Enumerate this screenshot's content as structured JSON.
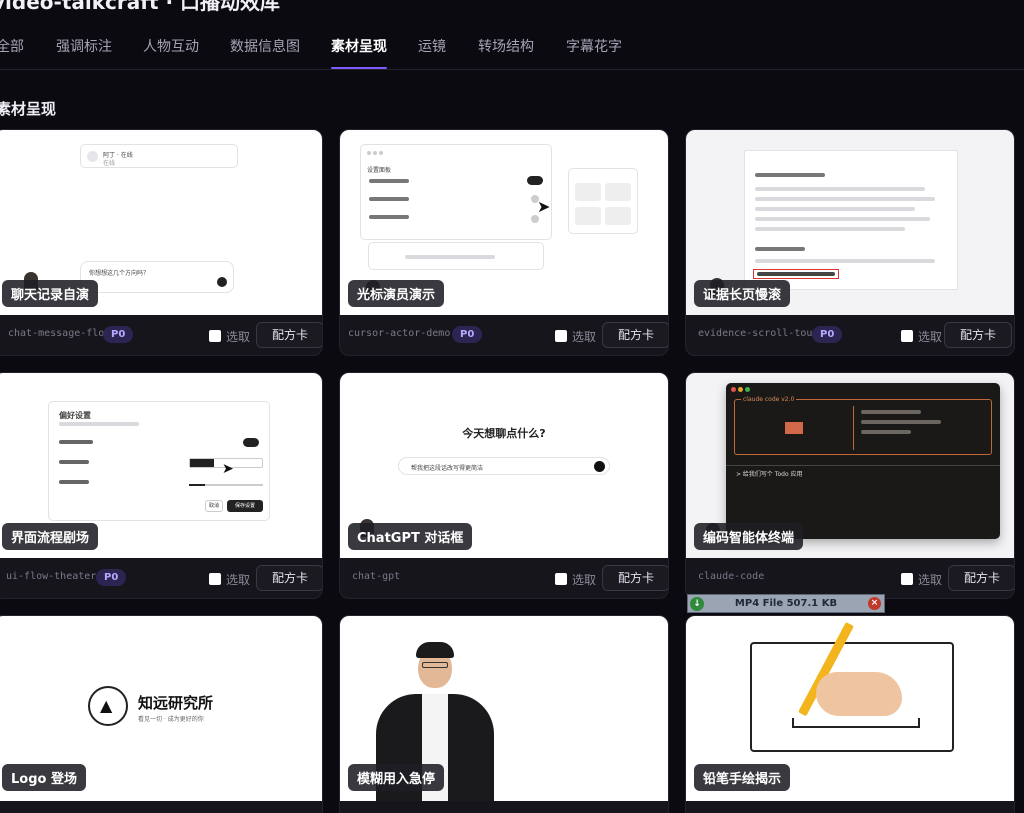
{
  "header": {
    "title": "video-talkcraft · 口播动效库"
  },
  "tabs": [
    {
      "label": "全部"
    },
    {
      "label": "强调标注"
    },
    {
      "label": "人物互动"
    },
    {
      "label": "数据信息图"
    },
    {
      "label": "素材呈现"
    },
    {
      "label": "运镜"
    },
    {
      "label": "转场结构"
    },
    {
      "label": "字幕花字"
    }
  ],
  "active_tab": "素材呈现",
  "section": {
    "title": "素材呈现"
  },
  "common": {
    "select_label": "选取",
    "recipe_label": "配方卡",
    "badge": "P0"
  },
  "cards": [
    {
      "label": "聊天记录自演",
      "slug": "chat-message-flow",
      "badge": "P0"
    },
    {
      "label": "光标演员演示",
      "slug": "cursor-actor-demo",
      "badge": "P0"
    },
    {
      "label": "证据长页慢滚",
      "slug": "evidence-scroll-tour",
      "badge": "P0"
    },
    {
      "label": "界面流程剧场",
      "slug": "ui-flow-theater",
      "badge": "P0"
    },
    {
      "label": "ChatGPT 对话框",
      "slug": "chat-gpt",
      "badge": ""
    },
    {
      "label": "编码智能体终端",
      "slug": "claude-code",
      "badge": ""
    },
    {
      "label": "Logo 登场",
      "slug": "",
      "badge": ""
    },
    {
      "label": "模糊用入急停",
      "slug": "",
      "badge": ""
    },
    {
      "label": "铅笔手绘揭示",
      "slug": "",
      "badge": ""
    }
  ],
  "thumbs": {
    "chat": {
      "contact": "阿丁 · 在线",
      "status": "在线",
      "input": "你想想这几个方向吗？"
    },
    "cursor": {
      "section": "设置面板"
    },
    "gpt": {
      "prompt": "今天想聊点什么?",
      "input": "帮我把这段话改写得更简洁"
    },
    "ui_flow": {
      "title": "偏好设置",
      "primary": "保存设置",
      "cancel": "取消"
    },
    "terminal": {
      "title": "claude code v2.0",
      "prompt": "> 给我们写个 Todo 应用"
    },
    "logo": {
      "name": "知远研究所",
      "tagline": "看见一切 · 成为更好的你"
    }
  },
  "file_banner": {
    "text": "MP4 File 507.1 KB"
  },
  "colors": {
    "accent": "#7c5cff",
    "background": "#0b0a10",
    "badge_bg": "#2c2552"
  }
}
